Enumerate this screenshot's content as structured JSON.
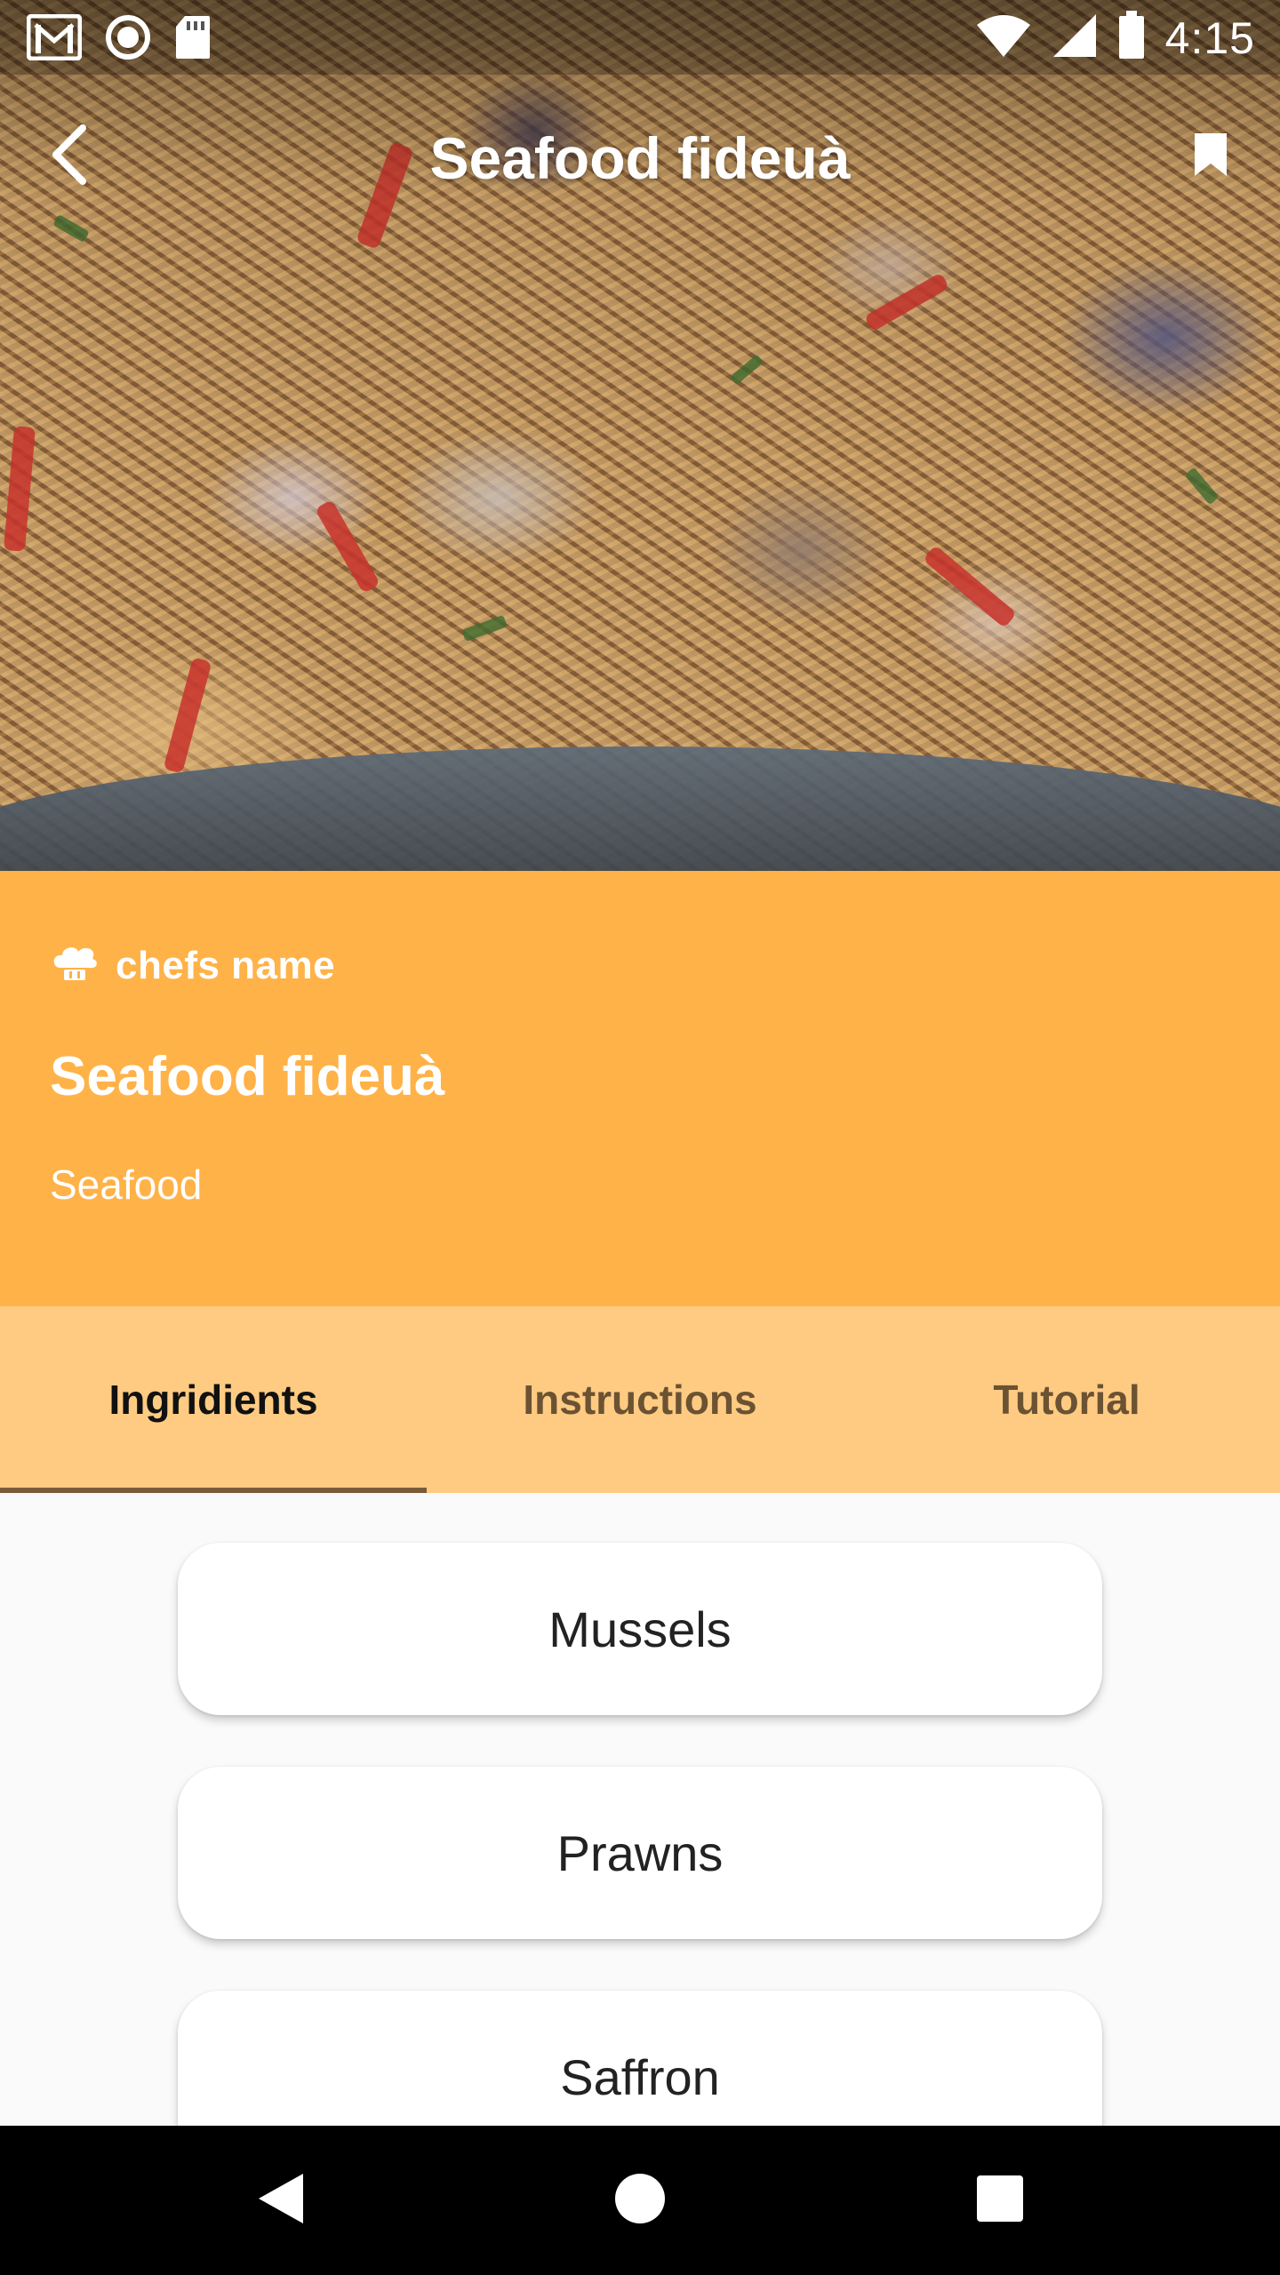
{
  "status_bar": {
    "time": "4:15",
    "left_icons": [
      "gmail-icon",
      "circle-notification-icon",
      "sd-card-icon"
    ],
    "right_icons": [
      "wifi-icon",
      "signal-icon",
      "battery-icon"
    ]
  },
  "app_bar": {
    "title": "Seafood fideuà",
    "back_icon": "back-arrow-icon",
    "bookmark_icon": "bookmark-icon"
  },
  "recipe": {
    "chef_icon": "chef-hat-icon",
    "chef_name": "chefs name",
    "title": "Seafood fideuà",
    "category": "Seafood"
  },
  "tabs": [
    {
      "label": "Ingridients",
      "active": true
    },
    {
      "label": "Instructions",
      "active": false
    },
    {
      "label": "Tutorial",
      "active": false
    }
  ],
  "ingredients": [
    "Mussels",
    "Prawns",
    "Saffron"
  ],
  "nav_bar": {
    "back_icon": "nav-back-triangle-icon",
    "home_icon": "nav-home-circle-icon",
    "recents_icon": "nav-recents-square-icon"
  },
  "colors": {
    "info_background": "#ffb247",
    "tabs_background": "#ffcb82",
    "tab_indicator": "#7a5a3a"
  }
}
